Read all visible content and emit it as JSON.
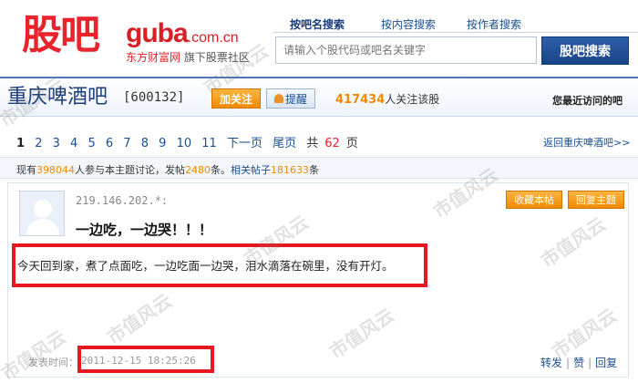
{
  "logo": {
    "cn": "股吧",
    "en": "guba",
    "domain": ".com.cn",
    "brand": "东方财富网",
    "sub": "旗下股票社区"
  },
  "search": {
    "tabs": [
      "按吧名搜索",
      "按内容搜索",
      "按作者搜索"
    ],
    "placeholder": "请输入个股代码或吧名关键字",
    "button": "股吧搜索"
  },
  "bar": {
    "name": "重庆啤酒吧",
    "code": "[600132]",
    "follow_label": "加关注",
    "remind_label": "提醒",
    "followers_count": "417434",
    "followers_suffix": "人关注该股",
    "recent_visit": "您最近访问的吧"
  },
  "pagination": {
    "pages": [
      "1",
      "2",
      "3",
      "4",
      "5",
      "6",
      "7",
      "8",
      "9",
      "10",
      "11"
    ],
    "next": "下一页",
    "last": "尾页",
    "total_prefix": "共",
    "total_pages": "62",
    "total_suffix": "页",
    "back_link": "返回重庆啤酒吧>>"
  },
  "stats": {
    "prefix": "现有",
    "participants": "398044",
    "mid": "人参与本主题讨论，发帖",
    "posts": "2480",
    "mid2": "条。",
    "related_label": "相关帖子",
    "related_count": "181633",
    "suffix": "条"
  },
  "post": {
    "author": "219.146.202.*:",
    "title": "一边吃，一边哭！！！",
    "collect_label": "收藏本帖",
    "reply_label": "回复主题",
    "content": "今天回到家，煮了点面吃，一边吃面一边哭，泪水滴落在碗里，没有开灯。",
    "time_label": "发表时间：",
    "time_value": "2011-12-15 18:25:26",
    "actions": [
      "转发",
      "赞",
      "回复"
    ]
  },
  "watermark": "市值风云",
  "colors": {
    "brand_red": "#e8232b",
    "link_blue": "#1a4f93",
    "accent_orange": "#f08a00",
    "highlight_red": "#e8171f"
  }
}
